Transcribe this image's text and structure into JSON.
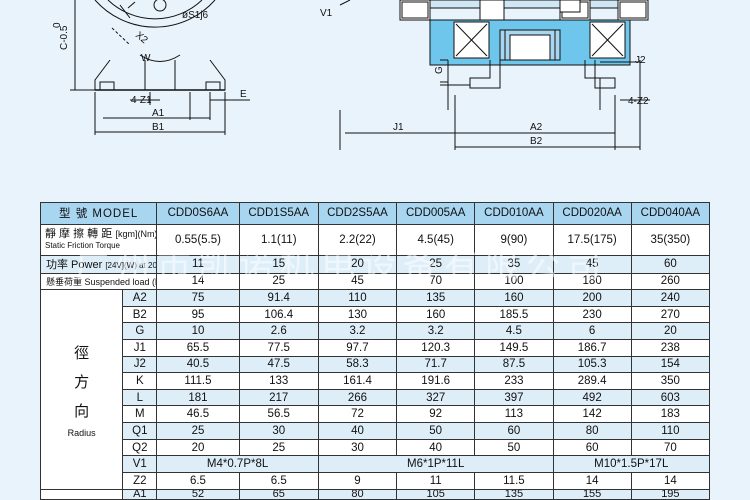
{
  "drawing": {
    "labels": {
      "c": "C-0.5",
      "c_sup": "0",
      "shaft": "øS1j6",
      "x2": "X2",
      "w": "W",
      "four_z1": "4-Z1",
      "e": "E",
      "a1": "A1",
      "b1": "B1",
      "v1": "V1",
      "g": "G",
      "j2": "J2",
      "four_z2": "4-Z2",
      "j1": "J1",
      "a2": "A2",
      "b2": "B2"
    }
  },
  "table": {
    "model_header": "型 號 MODEL",
    "models": [
      "CDD0S6AA",
      "CDD1S5AA",
      "CDD2S5AA",
      "CDD005AA",
      "CDD010AA",
      "CDD020AA",
      "CDD040AA"
    ],
    "torque_label_cn": "靜 摩 擦 轉 距",
    "torque_unit": "[kgm](Nm)",
    "torque_label_en": "Static Friction Torque",
    "torque": [
      "0.55(5.5)",
      "1.1(11)",
      "2.2(22)",
      "4.5(45)",
      "9(90)",
      "17.5(175)",
      "35(350)"
    ],
    "power_label_cn": "功率 Power",
    "power_unit": "[24V](W) at 20°C",
    "power": [
      "11",
      "15",
      "20",
      "25",
      "35",
      "45",
      "60"
    ],
    "load_label": "懸垂荷重 Suspended load (kgf)",
    "load": [
      "14",
      "25",
      "45",
      "70",
      "100",
      "180",
      "260"
    ],
    "radius_cn_1": "徑",
    "radius_cn_2": "方",
    "radius_cn_3": "向",
    "radius_en": "Radius",
    "rows": [
      {
        "dim": "A2",
        "values": [
          "75",
          "91.4",
          "110",
          "135",
          "160",
          "200",
          "240"
        ]
      },
      {
        "dim": "B2",
        "values": [
          "95",
          "106.4",
          "130",
          "160",
          "185.5",
          "230",
          "270"
        ]
      },
      {
        "dim": "G",
        "values": [
          "10",
          "2.6",
          "3.2",
          "3.2",
          "4.5",
          "6",
          "20"
        ]
      },
      {
        "dim": "J1",
        "values": [
          "65.5",
          "77.5",
          "97.7",
          "120.3",
          "149.5",
          "186.7",
          "238"
        ]
      },
      {
        "dim": "J2",
        "values": [
          "40.5",
          "47.5",
          "58.3",
          "71.7",
          "87.5",
          "105.3",
          "154"
        ]
      },
      {
        "dim": "K",
        "values": [
          "111.5",
          "133",
          "161.4",
          "191.6",
          "233",
          "289.4",
          "350"
        ]
      },
      {
        "dim": "L",
        "values": [
          "181",
          "217",
          "266",
          "327",
          "397",
          "492",
          "603"
        ]
      },
      {
        "dim": "M",
        "values": [
          "46.5",
          "56.5",
          "72",
          "92",
          "113",
          "142",
          "183"
        ]
      },
      {
        "dim": "Q1",
        "values": [
          "25",
          "30",
          "40",
          "50",
          "60",
          "80",
          "110"
        ]
      },
      {
        "dim": "Q2",
        "values": [
          "20",
          "25",
          "30",
          "40",
          "50",
          "60",
          "70"
        ]
      }
    ],
    "v1": {
      "dim": "V1",
      "v_a": "M4*0.7P*8L",
      "v_b": "M6*1P*11L",
      "v_c": "M10*1.5P*17L"
    },
    "z2": {
      "dim": "Z2",
      "values": [
        "6.5",
        "6.5",
        "9",
        "11",
        "11.5",
        "14",
        "14"
      ]
    },
    "a1": {
      "dim": "A1",
      "values": [
        "52",
        "65",
        "80",
        "105",
        "135",
        "155",
        "195"
      ]
    }
  },
  "watermark": "广州市凯诺机电设备有限公司",
  "colors": {
    "background": "#e9f3fb",
    "header_blue": "#a8d5f0",
    "light_cell": "#ddeef9",
    "drawing_blue": "#6ec6ec"
  }
}
